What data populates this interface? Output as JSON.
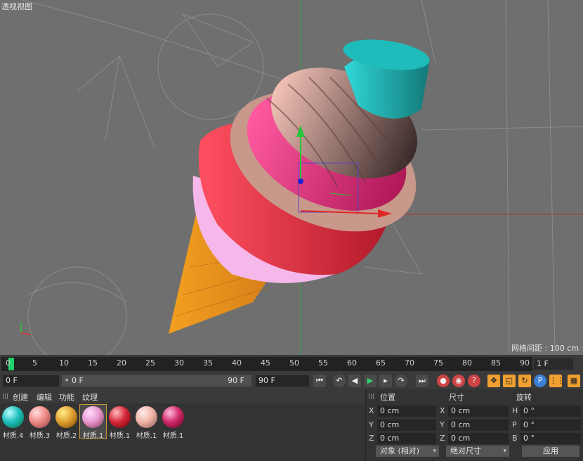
{
  "viewport": {
    "title": "透视视图",
    "grid_spacing": "网格间距 : 100 cm"
  },
  "timeline": {
    "ticks": [
      "0",
      "5",
      "10",
      "15",
      "20",
      "25",
      "30",
      "35",
      "40",
      "45",
      "50",
      "55",
      "60",
      "65",
      "70",
      "75",
      "80",
      "85",
      "90"
    ],
    "current_frame": "1 F"
  },
  "transport": {
    "start_frame": "0 F",
    "range_start": "0 F",
    "range_end": "90 F",
    "end_frame": "90 F",
    "icons": [
      "go-start-icon",
      "prev-key-icon",
      "step-back-icon",
      "play-icon",
      "step-forward-icon",
      "next-key-icon",
      "go-end-icon",
      "record-icon",
      "autokey-icon",
      "keyframe-help-icon",
      "move-icon",
      "scale-icon",
      "rotate-icon",
      "param-icon",
      "grid-dots-icon",
      "film-icon"
    ]
  },
  "materials": {
    "menu": [
      "创建",
      "编辑",
      "功能",
      "纹理"
    ],
    "items": [
      {
        "label": "材质.4",
        "color": "#1fbcbc"
      },
      {
        "label": "材质.3",
        "color": "#f08a86"
      },
      {
        "label": "材质.2",
        "color": "#e0a030"
      },
      {
        "label": "材质.1",
        "color": "#e89ad0"
      },
      {
        "label": "材质.1",
        "color": "#d8283a"
      },
      {
        "label": "材质.1",
        "color": "#f0b4a4"
      },
      {
        "label": "材质.1",
        "color": "#d02a6a"
      }
    ]
  },
  "attributes": {
    "headers": [
      "位置",
      "尺寸",
      "旋转"
    ],
    "position": [
      {
        "axis": "X",
        "value": "0 cm"
      },
      {
        "axis": "Y",
        "value": "0 cm"
      },
      {
        "axis": "Z",
        "value": "0 cm"
      }
    ],
    "size": [
      {
        "axis": "X",
        "value": "0 cm"
      },
      {
        "axis": "Y",
        "value": "0 cm"
      },
      {
        "axis": "Z",
        "value": "0 cm"
      }
    ],
    "rotation": [
      {
        "axis": "H",
        "value": "0 °"
      },
      {
        "axis": "P",
        "value": "0 °"
      },
      {
        "axis": "B",
        "value": "0 °"
      }
    ],
    "coord_mode": "对象 (相对)",
    "size_mode": "绝对尺寸",
    "apply": "应用"
  }
}
